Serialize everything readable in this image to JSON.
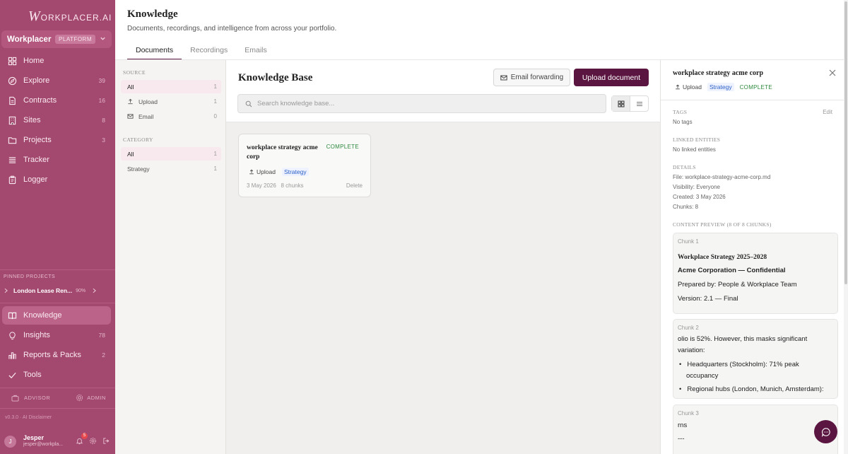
{
  "app": {
    "logo_initial": "W",
    "logo_rest": "ORKPLACER.AI",
    "workspace": "Workplacer",
    "workspace_badge": "PLATFORM"
  },
  "nav": {
    "home": {
      "label": "Home"
    },
    "explore": {
      "label": "Explore",
      "count": "39"
    },
    "contracts": {
      "label": "Contracts",
      "count": "16"
    },
    "sites": {
      "label": "Sites",
      "count": "8"
    },
    "projects": {
      "label": "Projects",
      "count": "3"
    },
    "tracker": {
      "label": "Tracker"
    },
    "logger": {
      "label": "Logger"
    },
    "knowledge": {
      "label": "Knowledge"
    },
    "insights": {
      "label": "Insights",
      "count": "78"
    },
    "reports": {
      "label": "Reports & Packs",
      "count": "2"
    },
    "tools": {
      "label": "Tools"
    }
  },
  "pinned": {
    "title": "PINNED PROJECTS",
    "item_label": "London Lease Ren...",
    "item_pct": "90%",
    "progress": 0.9
  },
  "roles": {
    "advisor": "ADVISOR",
    "admin": "ADMIN"
  },
  "version": "v0.3.0  ·  AI Disclaimer",
  "user": {
    "initial": "J",
    "name": "Jesper",
    "email": "jesper@workpla...",
    "notifications": "5"
  },
  "header": {
    "title": "Knowledge",
    "subtitle": "Documents, recordings, and intelligence from across your portfolio.",
    "tabs": [
      "Documents",
      "Recordings",
      "Emails"
    ]
  },
  "filters": {
    "source_title": "SOURCE",
    "source": [
      {
        "label": "All",
        "count": "1"
      },
      {
        "label": "Upload",
        "count": "1"
      },
      {
        "label": "Email",
        "count": "0"
      }
    ],
    "category_title": "CATEGORY",
    "category": [
      {
        "label": "All",
        "count": "1"
      },
      {
        "label": "Strategy",
        "count": "1"
      }
    ]
  },
  "kb": {
    "title": "Knowledge Base",
    "email_forwarding": "Email forwarding",
    "upload_document": "Upload document",
    "search_placeholder": "Search knowledge base..."
  },
  "document": {
    "title": "workplace strategy acme corp",
    "status": "COMPLETE",
    "source": "Upload",
    "category": "Strategy",
    "date": "3 May 2026",
    "chunks": "8 chunks",
    "delete_label": "Delete"
  },
  "detail": {
    "title": "workplace strategy acme corp",
    "source": "Upload",
    "category": "Strategy",
    "status": "COMPLETE",
    "tags_title": "TAGS",
    "tags_edit": "Edit",
    "tags_value": "No tags",
    "linked_title": "LINKED ENTITIES",
    "linked_value": "No linked entities",
    "details_title": "DETAILS",
    "file": "File: workplace-strategy-acme-corp.md",
    "visibility": "Visibility: Everyone",
    "created": "Created: 3 May 2026",
    "chunks": "Chunks: 8",
    "preview_title": "CONTENT PREVIEW (8 OF 8 CHUNKS)",
    "chunk1": {
      "label": "Chunk 1",
      "heading": "Workplace Strategy 2025–2028",
      "subheading": "Acme Corporation — Confidential",
      "prepared": "Prepared by: People & Workplace Team",
      "version": "Version: 2.1 — Final"
    },
    "chunk2": {
      "label": "Chunk 2",
      "line1": "olio is 52%. However, this masks significant",
      "line2": "variation:",
      "bullet1a": "Headquarters (Stockholm): 71% peak",
      "bullet1b": "occupancy",
      "bullet2": "Regional hubs (London, Munich, Amsterdam):"
    },
    "chunk3": {
      "label": "Chunk 3",
      "line1": "rns",
      "line2": "---"
    }
  },
  "colors": {
    "sidebar": "#a3486f",
    "primary": "#5a1640",
    "complete": "#2f8a3e",
    "strategy": "#2a5ec4"
  }
}
